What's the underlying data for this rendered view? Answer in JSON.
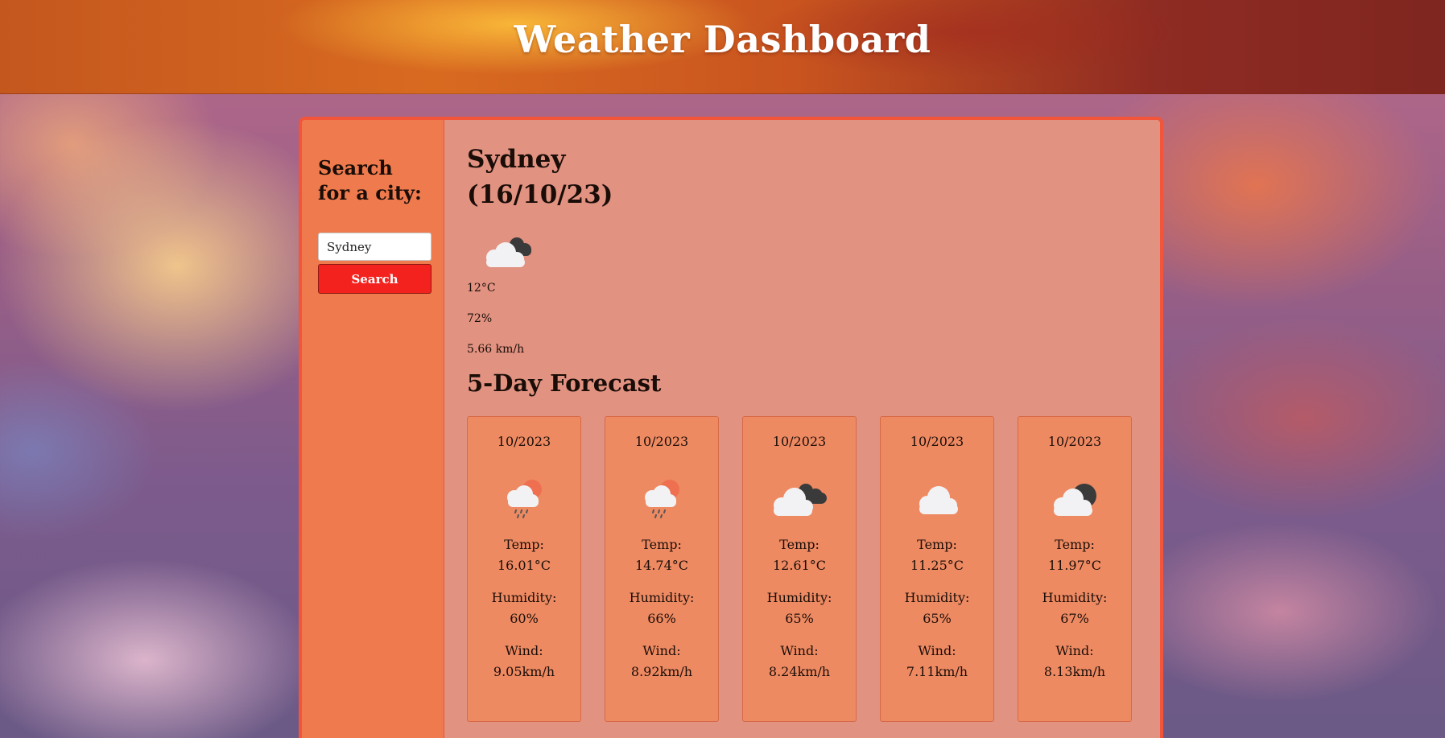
{
  "header": {
    "title": "Weather Dashboard"
  },
  "sidebar": {
    "heading": "Search for a city:",
    "input_value": "Sydney",
    "search_label": "Search"
  },
  "current": {
    "city_line": "Sydney",
    "date_line": "(16/10/23)",
    "icon": "partly-cloudy-night-icon",
    "temp": "12°C",
    "humidity": "72%",
    "wind": "5.66 km/h"
  },
  "forecast": {
    "title": "5-Day Forecast",
    "days": [
      {
        "date": "10/2023",
        "icon": "rain-sun-icon",
        "temp_label": "Temp:",
        "temp": "16.01°C",
        "humidity_label": "Humidity:",
        "humidity": "60%",
        "wind_label": "Wind:",
        "wind": "9.05km/h"
      },
      {
        "date": "10/2023",
        "icon": "rain-sun-icon",
        "temp_label": "Temp:",
        "temp": "14.74°C",
        "humidity_label": "Humidity:",
        "humidity": "66%",
        "wind_label": "Wind:",
        "wind": "8.92km/h"
      },
      {
        "date": "10/2023",
        "icon": "broken-clouds-icon",
        "temp_label": "Temp:",
        "temp": "12.61°C",
        "humidity_label": "Humidity:",
        "humidity": "65%",
        "wind_label": "Wind:",
        "wind": "8.24km/h"
      },
      {
        "date": "10/2023",
        "icon": "cloud-icon",
        "temp_label": "Temp:",
        "temp": "11.25°C",
        "humidity_label": "Humidity:",
        "humidity": "65%",
        "wind_label": "Wind:",
        "wind": "7.11km/h"
      },
      {
        "date": "10/2023",
        "icon": "cloud-moon-icon",
        "temp_label": "Temp:",
        "temp": "11.97°C",
        "humidity_label": "Humidity:",
        "humidity": "67%",
        "wind_label": "Wind:",
        "wind": "8.13km/h"
      }
    ]
  },
  "colors": {
    "accent": "#f2553a",
    "sidebar_bg": "#ee7a4d",
    "main_bg": "#e19281",
    "card_bg": "#ee8a62",
    "button_bg": "#f4221f"
  }
}
